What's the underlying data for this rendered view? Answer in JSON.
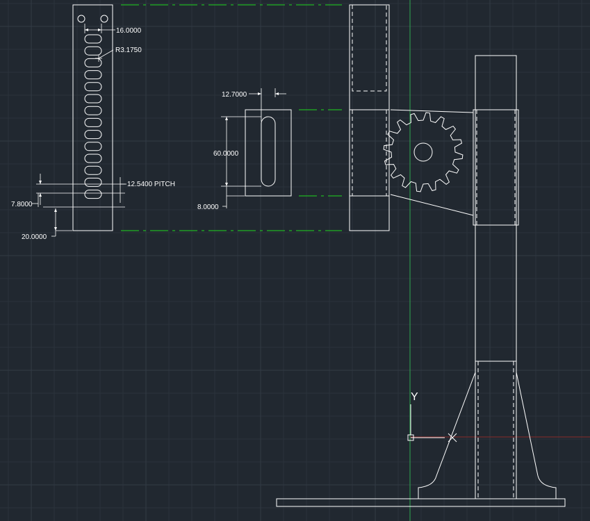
{
  "app": "CAD drawing viewport",
  "colors": {
    "background": "#212830",
    "geometry": "#ffffff",
    "extension_lines": "#1ed81e",
    "y_axis": "#2fa84f",
    "x_axis": "#8a2b2b"
  },
  "dimensions": {
    "slot_spacing": "16.0000",
    "hole_radius": "R3.1750",
    "pitch": "12.5400 PITCH",
    "pitch_offset": "7.8000",
    "bottom_offset": "20.0000",
    "slot_width": "12.7000",
    "slot_length": "60.0000",
    "slot_offset": "8.0000"
  },
  "ucs": {
    "y_label": "Y",
    "icon": "ucs-icon"
  }
}
